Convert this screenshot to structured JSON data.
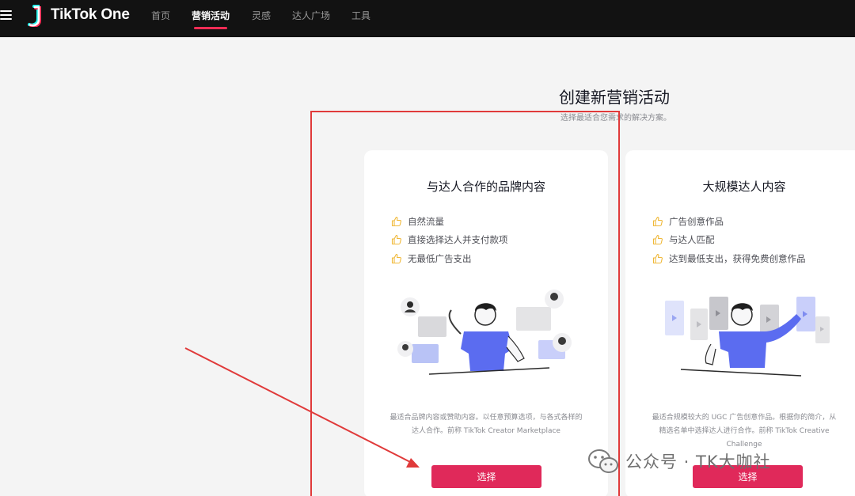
{
  "header": {
    "logo_text": "TikTok One",
    "nav": [
      {
        "label": "首页",
        "active": false
      },
      {
        "label": "营销活动",
        "active": true
      },
      {
        "label": "灵感",
        "active": false
      },
      {
        "label": "达人广场",
        "active": false
      },
      {
        "label": "工具",
        "active": false
      }
    ]
  },
  "main": {
    "title": "创建新营销活动",
    "subtitle": "选择最适合您需求的解决方案。",
    "cards": [
      {
        "title": "与达人合作的品牌内容",
        "features": [
          "自然流量",
          "直接选择达人并支付款项",
          "无最低广告支出"
        ],
        "description": "最适合品牌内容或赞助内容。以任意预算选项，与各式各样的达人合作。前称 TikTok Creator Marketplace",
        "button": "选择"
      },
      {
        "title": "大规模达人内容",
        "features": [
          "广告创意作品",
          "与达人匹配",
          "达到最低支出，获得免费创意作品"
        ],
        "description": "最适合规模较大的 UGC 广告创意作品。根据你的简介，从精选名单中选择达人进行合作。前称 TikTok Creative Challenge",
        "button": "选择"
      }
    ]
  },
  "watermark": {
    "text": "公众号 · TK大咖社"
  },
  "colors": {
    "accent": "#fe2c55",
    "button": "#e0295a",
    "annotation": "#e03a3a",
    "thumb": "#f0b93a",
    "figure_shirt": "#5b6cf0"
  }
}
